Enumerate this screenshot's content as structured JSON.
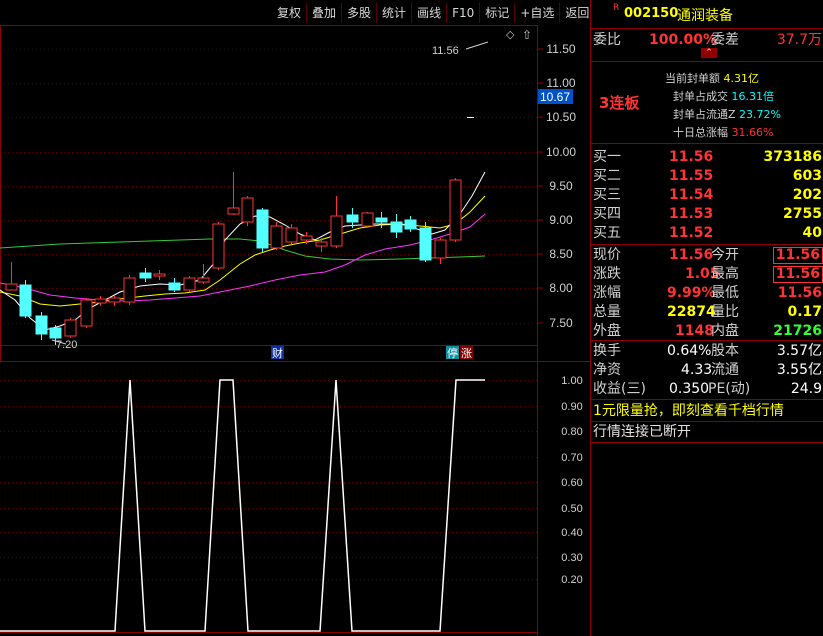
{
  "toolbar": {
    "items": [
      "复权",
      "叠加",
      "多股",
      "统计",
      "画线",
      "F10",
      "标记",
      "+自选",
      "返回"
    ]
  },
  "price_axis": {
    "ticks": [
      "11.50",
      "11.00",
      "10.50",
      "10.00",
      "9.50",
      "9.00",
      "8.50",
      "8.00",
      "7.50"
    ],
    "current_price": "10.67"
  },
  "indicator_axis": {
    "ticks": [
      "1.00",
      "0.90",
      "0.80",
      "0.70",
      "0.60",
      "0.50",
      "0.40",
      "0.30",
      "0.20"
    ]
  },
  "annotations": {
    "high_label": "11.56",
    "low_label": "7.20",
    "marker_cai": "财",
    "marker_ting": "停",
    "marker_zhang": "涨"
  },
  "stock": {
    "r_mark": "R",
    "code": "002150",
    "name": "通润装备"
  },
  "weibi": {
    "label1": "委比",
    "value1": "100.00%",
    "label2": "委差",
    "value2": "37.7万"
  },
  "seal": {
    "lianban": "3连板",
    "lines": [
      {
        "label": "当前封单额",
        "value": "4.31亿"
      },
      {
        "label": "封单占成交",
        "value": "16.31倍"
      },
      {
        "label": "封单占流通Z",
        "value": "23.72%"
      },
      {
        "label": "十日总涨幅",
        "value": "31.66%"
      }
    ]
  },
  "order_book": [
    {
      "label": "买一",
      "price": "11.56",
      "volume": "373186"
    },
    {
      "label": "买二",
      "price": "11.55",
      "volume": "603"
    },
    {
      "label": "买三",
      "price": "11.54",
      "volume": "202"
    },
    {
      "label": "买四",
      "price": "11.53",
      "volume": "2755"
    },
    {
      "label": "买五",
      "price": "11.52",
      "volume": "40"
    }
  ],
  "quote": {
    "xianjia_label": "现价",
    "xianjia": "11.56",
    "jinkai_label": "今开",
    "jinkai": "11.56",
    "zhangdie_label": "涨跌",
    "zhangdie": "1.05",
    "zuigao_label": "最高",
    "zuigao": "11.56",
    "zhangfu_label": "涨幅",
    "zhangfu": "9.99%",
    "zuidi_label": "最低",
    "zuidi": "11.56",
    "zongliang_label": "总量",
    "zongliang": "22874",
    "liangbi_label": "量比",
    "liangbi": "0.17",
    "waipan_label": "外盘",
    "waipan": "1148",
    "neipan_label": "内盘",
    "neipan": "21726"
  },
  "fundamentals": {
    "huanshou_label": "换手",
    "huanshou": "0.64%",
    "guben_label": "股本",
    "guben": "3.57亿",
    "jingzi_label": "净资",
    "jingzi": "4.33",
    "liutong_label": "流通",
    "liutong": "3.55亿",
    "shouyi_label": "收益(三)",
    "shouyi": "0.350",
    "pe_label": "PE(动)",
    "pe": "24.9"
  },
  "promo": {
    "line1": "1元限量抢，即刻查看千档行情",
    "line2": "行情连接已断开"
  },
  "colors": {
    "up": "#ff3333",
    "down": "#54ffff",
    "ma_white": "#ffffff",
    "ma_yellow": "#ffff00",
    "ma_magenta": "#ff33ff",
    "ma_green": "#33cc33",
    "border": "#8b0000"
  }
}
